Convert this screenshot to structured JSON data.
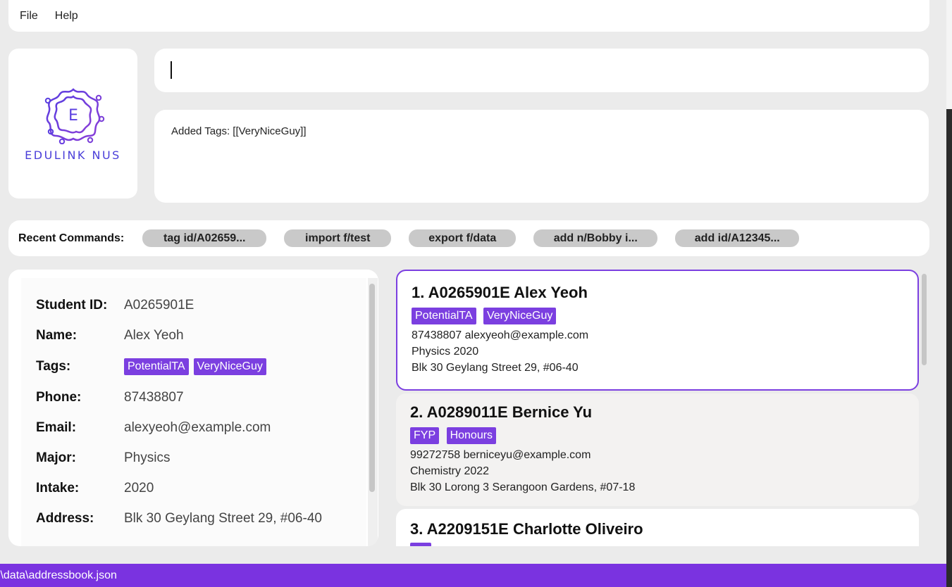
{
  "menu": {
    "items": [
      "File",
      "Help"
    ]
  },
  "logo": {
    "letter": "E",
    "text": "EDULINK NUS"
  },
  "command": {
    "value": "",
    "placeholder": ""
  },
  "result": {
    "text": "Added Tags: [[VeryNiceGuy]]"
  },
  "recent": {
    "label": "Recent Commands:",
    "commands": [
      "tag id/A02659...",
      "import f/test",
      "export f/data",
      "add n/Bobby i...",
      "add id/A12345..."
    ]
  },
  "detail": {
    "rows": [
      {
        "key": "Student ID:",
        "value": "A0265901E"
      },
      {
        "key": "Name:",
        "value": "Alex Yeoh"
      },
      {
        "key": "Tags:",
        "tags": [
          "PotentialTA",
          "VeryNiceGuy"
        ]
      },
      {
        "key": "Phone:",
        "value": "87438807"
      },
      {
        "key": "Email:",
        "value": "alexyeoh@example.com"
      },
      {
        "key": "Major:",
        "value": "Physics"
      },
      {
        "key": "Intake:",
        "value": "2020"
      },
      {
        "key": "Address:",
        "value": "Blk 30 Geylang Street 29, #06-40"
      }
    ]
  },
  "list": {
    "cards": [
      {
        "title": "1.  A0265901E Alex Yeoh",
        "tags": [
          "PotentialTA",
          "VeryNiceGuy"
        ],
        "contact": "87438807  alexyeoh@example.com",
        "major": "Physics  2020",
        "address": "Blk 30 Geylang Street 29, #06-40"
      },
      {
        "title": "2.  A0289011E Bernice Yu",
        "tags": [
          "FYP",
          "Honours"
        ],
        "contact": "99272758  berniceyu@example.com",
        "major": "Chemistry  2022",
        "address": "Blk 30 Lorong 3 Serangoon Gardens, #07-18"
      },
      {
        "title": "3.  A2209151E Charlotte Oliveiro",
        "tags": [
          ""
        ],
        "contact": "",
        "major": "",
        "address": ""
      }
    ]
  },
  "status": {
    "path": ".\\data\\addressbook.json"
  },
  "colors": {
    "accent": "#7b3fe0",
    "statusbar": "#7a33e0",
    "logo": "#4a3ed9"
  }
}
